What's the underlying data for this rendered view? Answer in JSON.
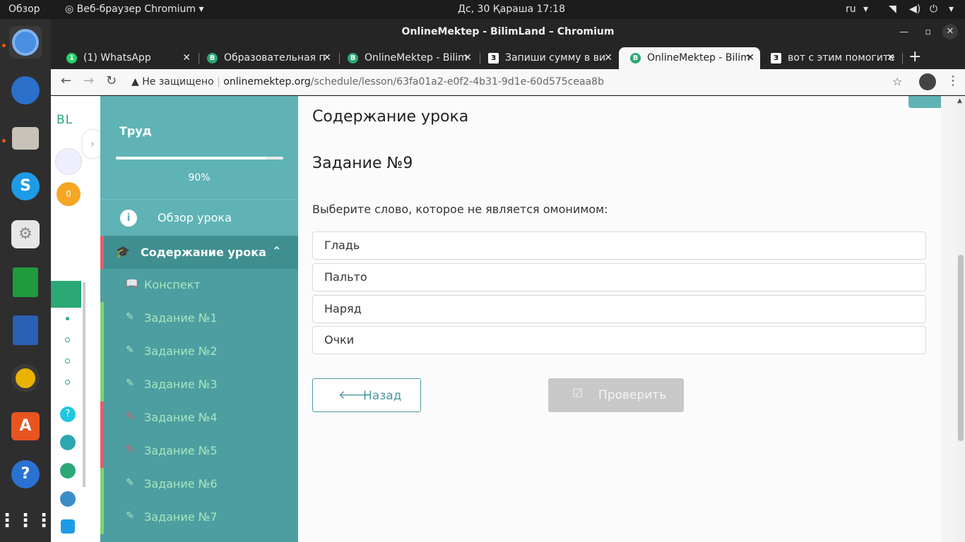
{
  "topbar": {
    "overview": "Обзор",
    "browser_menu": "Веб-браузер Chromium",
    "clock": "Дс, 30 Қараша  17:18",
    "lang": "ru"
  },
  "window": {
    "title": "OnlineMektep - BilimLand – Chromium"
  },
  "tabs": [
    {
      "label": "(1) WhatsApp"
    },
    {
      "label": "Образовательная п"
    },
    {
      "label": "OnlineMektep - Bilim"
    },
    {
      "label": "Запиши сумму в ви"
    },
    {
      "label": "OnlineMektep - Bilim"
    },
    {
      "label": "вот с этим помогите"
    }
  ],
  "address": {
    "security": "Не защищено",
    "domain": "onlinemektep.org",
    "path": "/schedule/lesson/63fa01a2-e0f2-4b31-9d1e-60d575ceaa8b"
  },
  "leftbar": {
    "logo": "BL",
    "coins": "0"
  },
  "sidebar": {
    "subject": "Труд",
    "progress": 0.9,
    "progress_label": "90%",
    "overview": "Обзор урока",
    "content": "Содержание урока",
    "items": [
      {
        "label": "Конспект",
        "icon": "book-icon",
        "status": "none"
      },
      {
        "label": "Задание №1",
        "icon": "edit-icon",
        "status": "correct"
      },
      {
        "label": "Задание №2",
        "icon": "edit-icon",
        "status": "correct"
      },
      {
        "label": "Задание №3",
        "icon": "edit-icon",
        "status": "correct"
      },
      {
        "label": "Задание №4",
        "icon": "edit-icon",
        "status": "wrong"
      },
      {
        "label": "Задание №5",
        "icon": "edit-icon",
        "status": "wrong"
      },
      {
        "label": "Задание №6",
        "icon": "edit-icon",
        "status": "correct"
      },
      {
        "label": "Задание №7",
        "icon": "edit-icon",
        "status": "correct"
      }
    ]
  },
  "main": {
    "heading": "Содержание урока",
    "task_title": "Задание №9",
    "question": "Выберите слово, которое не является омонимом:",
    "options": [
      "Гладь",
      "Пальто",
      "Наряд",
      "Очки"
    ],
    "back_label": "Назад",
    "check_label": "Проверить"
  }
}
